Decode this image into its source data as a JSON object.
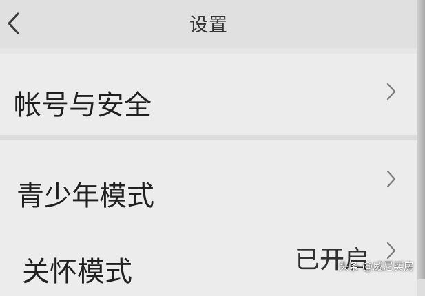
{
  "header": {
    "title": "设置"
  },
  "settings": {
    "items": [
      {
        "label": "帐号与安全",
        "value": ""
      },
      {
        "label": "青少年模式",
        "value": ""
      },
      {
        "label": "关怀模式",
        "value": "已开启"
      }
    ]
  },
  "watermark": {
    "text": "头条 @威尼买房"
  },
  "icons": {
    "back": "chevron-left-icon",
    "row_arrow": "chevron-right-icon"
  },
  "colors": {
    "background": "#e6e6e6",
    "row": "#ececec",
    "text": "#1e1e1e"
  }
}
